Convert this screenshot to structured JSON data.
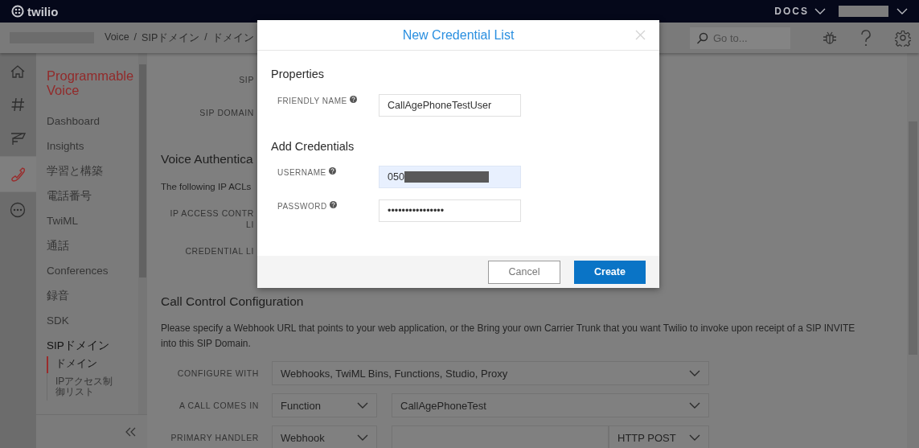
{
  "topbar": {
    "logo": "twilio",
    "docs": "DOCS"
  },
  "breadcrumb": {
    "items": [
      "Voice",
      "SIPドメイン",
      "ドメイン"
    ],
    "separator": "/"
  },
  "search": {
    "placeholder": "Go to..."
  },
  "rail": [
    {
      "kind": "home",
      "selected": false
    },
    {
      "kind": "hash",
      "selected": false
    },
    {
      "kind": "note",
      "selected": false
    },
    {
      "kind": "phone",
      "selected": true
    },
    {
      "kind": "more",
      "selected": false
    }
  ],
  "nav": {
    "title": "Programmable Voice",
    "items": [
      {
        "label": "Dashboard",
        "expanded": false
      },
      {
        "label": "Insights",
        "expanded": false
      },
      {
        "label": "学習と構築",
        "expanded": false
      },
      {
        "label": "電話番号",
        "expanded": false
      },
      {
        "label": "TwiML",
        "expanded": false
      },
      {
        "label": "通話",
        "expanded": false
      },
      {
        "label": "Conferences",
        "expanded": false
      },
      {
        "label": "録音",
        "expanded": false
      },
      {
        "label": "SDK",
        "expanded": false
      },
      {
        "label": "SIPドメイン",
        "expanded": true,
        "children": [
          {
            "label": "ドメイン",
            "selected": true
          },
          {
            "label": "IPアクセス制御リスト",
            "selected": false
          }
        ]
      }
    ]
  },
  "content": {
    "upper_labels": [
      "SIP",
      "SIP DOMAIN"
    ],
    "voice_auth": {
      "heading": "Voice Authentica",
      "text": "The following IP ACLs",
      "labels": [
        [
          "IP ACCESS CONTR",
          "LI"
        ],
        [
          "CREDENTIAL LI"
        ]
      ]
    },
    "call_control": {
      "heading": "Call Control Configuration",
      "text": "Please specify a Webhook URL that points to your web application, or the Bring your own Carrier Trunk that you want Twilio to invoke upon receipt of a SIP INVITE into this SIP Domain.",
      "rows": [
        {
          "label": "CONFIGURE WITH",
          "controls": [
            {
              "kind": "select",
              "value": "Webhooks, TwiML Bins, Functions, Studio, Proxy"
            }
          ]
        },
        {
          "label": "A CALL COMES IN",
          "controls": [
            {
              "kind": "select",
              "value": "Function"
            },
            {
              "kind": "select",
              "value": "CallAgePhoneTest"
            }
          ]
        },
        {
          "label": "PRIMARY HANDLER",
          "controls": [
            {
              "kind": "select",
              "value": "Webhook"
            },
            {
              "kind": "input"
            },
            {
              "kind": "select",
              "value": "HTTP POST"
            }
          ]
        }
      ]
    }
  },
  "modal": {
    "title": "New Credential List",
    "sections": [
      {
        "heading": "Properties",
        "fields": [
          {
            "label": "FRIENDLY NAME",
            "value": "CallAgePhoneTestUser",
            "focused": false,
            "redacted": false
          }
        ]
      },
      {
        "heading": "Add Credentials",
        "fields": [
          {
            "label": "USERNAME",
            "value": "050",
            "focused": true,
            "redacted": true
          },
          {
            "label": "PASSWORD",
            "value": "••••••••••••••••",
            "focused": false,
            "redacted": false
          }
        ]
      }
    ],
    "buttons": [
      {
        "label": "Cancel",
        "kind": "secondary"
      },
      {
        "label": "Create",
        "kind": "primary"
      }
    ]
  }
}
